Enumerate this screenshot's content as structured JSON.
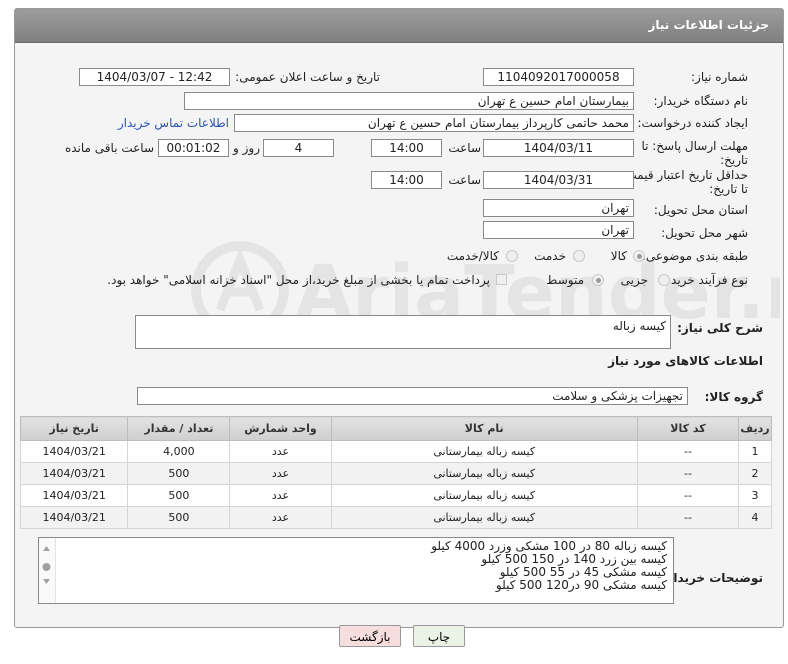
{
  "header": {
    "title": "جزئیات اطلاعات نیاز"
  },
  "fields": {
    "need_number_label": "شماره نیاز:",
    "need_number": "1104092017000058",
    "announce_label": "تاریخ و ساعت اعلان عمومی:",
    "announce_value": "1404/03/07 - 12:42",
    "buyer_label": "نام دستگاه خریدار:",
    "buyer_value": "بیمارستان امام حسین  ع  تهران",
    "creator_label": "ایجاد کننده درخواست:",
    "creator_value": "محمد حاتمی کارپرداز بیمارستان امام حسین  ع  تهران",
    "contact_link": "اطلاعات تماس خریدار",
    "deadline_label": "مهلت ارسال پاسخ: تا تاریخ:",
    "deadline_date": "1404/03/11",
    "time_label": "ساعت",
    "deadline_time": "14:00",
    "days_value": "4",
    "days_label": "روز و",
    "remaining_value": "00:01:02",
    "remaining_label": "ساعت باقی مانده",
    "price_validity_label": "حداقل تاریخ اعتبار قیمت: تا تاریخ:",
    "price_validity_date": "1404/03/31",
    "price_validity_time": "14:00",
    "province_label": "استان محل تحویل:",
    "province_value": "تهران",
    "city_label": "شهر محل تحویل:",
    "city_value": "تهران",
    "category_label": "طبقه بندی موضوعی:",
    "category_options": [
      "کالا",
      "خدمت",
      "کالا/خدمت"
    ],
    "process_label": "نوع فرآیند خرید :",
    "process_options": [
      "جزیی",
      "متوسط"
    ],
    "payment_note": "پرداخت تمام یا بخشی از مبلغ خرید،از محل \"اسناد خزانه اسلامی\" خواهد بود."
  },
  "summary": {
    "label": "شرح کلی نیاز:",
    "value": "کیسه زباله"
  },
  "goods_info_title": "اطلاعات کالاهای مورد نیاز",
  "goods_group": {
    "label": "گروه کالا:",
    "value": "تجهیزات پزشکی و سلامت"
  },
  "table": {
    "headers": [
      "ردیف",
      "کد کالا",
      "نام کالا",
      "واحد شمارش",
      "تعداد / مقدار",
      "تاریخ نیاز"
    ],
    "rows": [
      [
        "1",
        "--",
        "کیسه زباله بیمارستانی",
        "عدد",
        "4,000",
        "1404/03/21"
      ],
      [
        "2",
        "--",
        "کیسه زباله بیمارستانی",
        "عدد",
        "500",
        "1404/03/21"
      ],
      [
        "3",
        "--",
        "کیسه زباله بیمارستانی",
        "عدد",
        "500",
        "1404/03/21"
      ],
      [
        "4",
        "--",
        "کیسه زباله بیمارستانی",
        "عدد",
        "500",
        "1404/03/21"
      ]
    ]
  },
  "buyer_notes": {
    "label": "توضیحات خریدار:",
    "lines": [
      "کیسه زباله 80 در 100 مشکی وزرد 4000 کیلو",
      "کیسه بین زرد 140 در 150  500 کیلو",
      "کیسه مشکی 45 در 55  500 کیلو",
      "کیسه مشکی 90 در120   500 کیلو"
    ]
  },
  "buttons": {
    "print": "چاپ",
    "back": "بازگشت"
  },
  "watermark": "AriaTender.neT"
}
